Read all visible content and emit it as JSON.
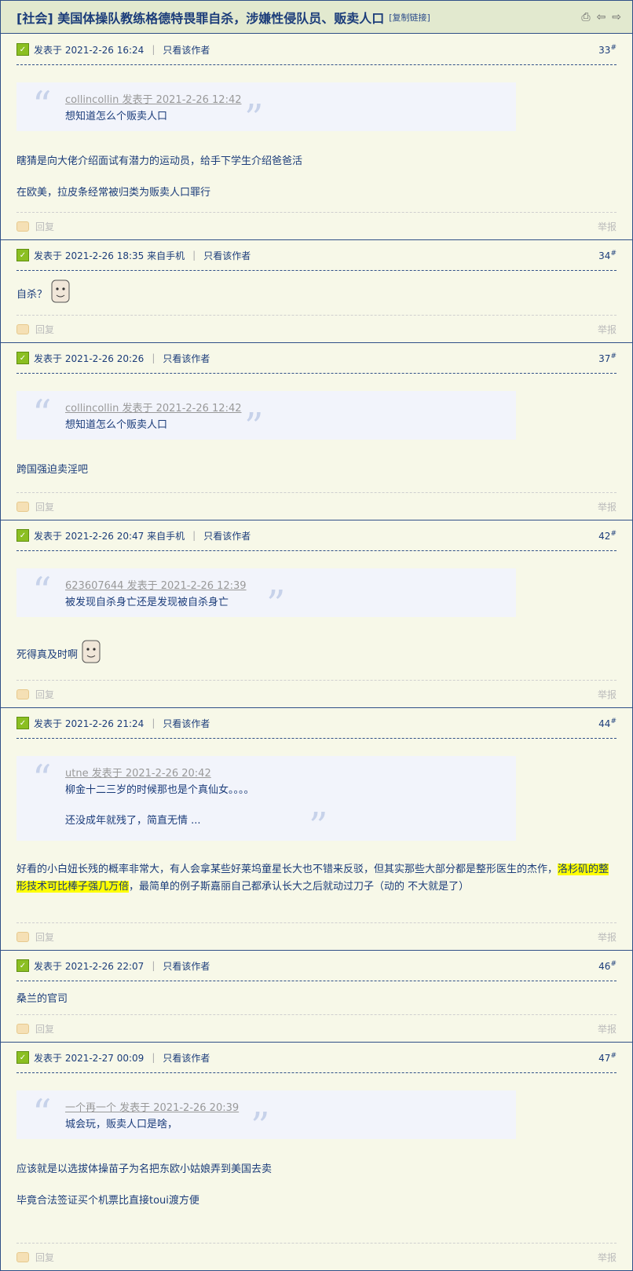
{
  "header": {
    "title": "[社会] 美国体操队教练格德特畏罪自杀，涉嫌性侵队员、贩卖人口",
    "copy_link": "[复制链接]"
  },
  "common": {
    "reply": "回复",
    "report": "举报",
    "view_author": "只看该作者"
  },
  "posts": [
    {
      "meta": "发表于 2021-2-26 16:24",
      "floor": "33",
      "quote": {
        "head": "collincollin 发表于 2021-2-26 12:42",
        "lines": [
          "想知道怎么个贩卖人口"
        ]
      },
      "content": [
        "瞎猜是向大佬介绍面试有潜力的运动员，给手下学生介绍爸爸活",
        "在欧美，拉皮条经常被归类为贩卖人口罪行"
      ]
    },
    {
      "meta": "发表于 2021-2-26 18:35 来自手机",
      "floor": "34",
      "content": [
        "自杀？"
      ]
    },
    {
      "meta": "发表于 2021-2-26 20:26",
      "floor": "37",
      "quote": {
        "head": "collincollin 发表于 2021-2-26 12:42",
        "lines": [
          "想知道怎么个贩卖人口"
        ]
      },
      "content": [
        "跨国强迫卖淫吧"
      ]
    },
    {
      "meta": "发表于 2021-2-26 20:47 来自手机",
      "floor": "42",
      "quote": {
        "head": "623607644 发表于 2021-2-26 12:39",
        "lines": [
          "被发现自杀身亡还是发现被自杀身亡"
        ]
      },
      "content": [
        "死得真及时啊"
      ]
    },
    {
      "meta": "发表于 2021-2-26 21:24",
      "floor": "44",
      "quote": {
        "head": "utne 发表于 2021-2-26 20:42",
        "lines": [
          "柳金十二三岁的时候那也是个真仙女。。。。",
          "还没成年就残了，简直无情 ..."
        ]
      },
      "content_a": "好看的小白妞长残的概率非常大，有人会拿某些好莱坞童星长大也不错来反驳，但其实那些大部分都是整形医生的杰作，",
      "content_hl": "洛杉矶的整形技术可比棒子强几万倍",
      "content_b": "，最简单的例子斯嘉丽自己都承认长大之后就动过刀子（动的 不大就是了）"
    },
    {
      "meta": "发表于 2021-2-26 22:07",
      "floor": "46",
      "content": [
        "桑兰的官司"
      ]
    },
    {
      "meta": "发表于 2021-2-27 00:09",
      "floor": "47",
      "quote": {
        "head": "一个再一个 发表于 2021-2-26 20:39",
        "lines": [
          "城会玩，贩卖人口是啥，"
        ]
      },
      "content": [
        "应该就是以选拔体操苗子为名把东欧小姑娘弄到美国去卖",
        "毕竟合法签证买个机票比直接toui渡方便"
      ]
    }
  ]
}
